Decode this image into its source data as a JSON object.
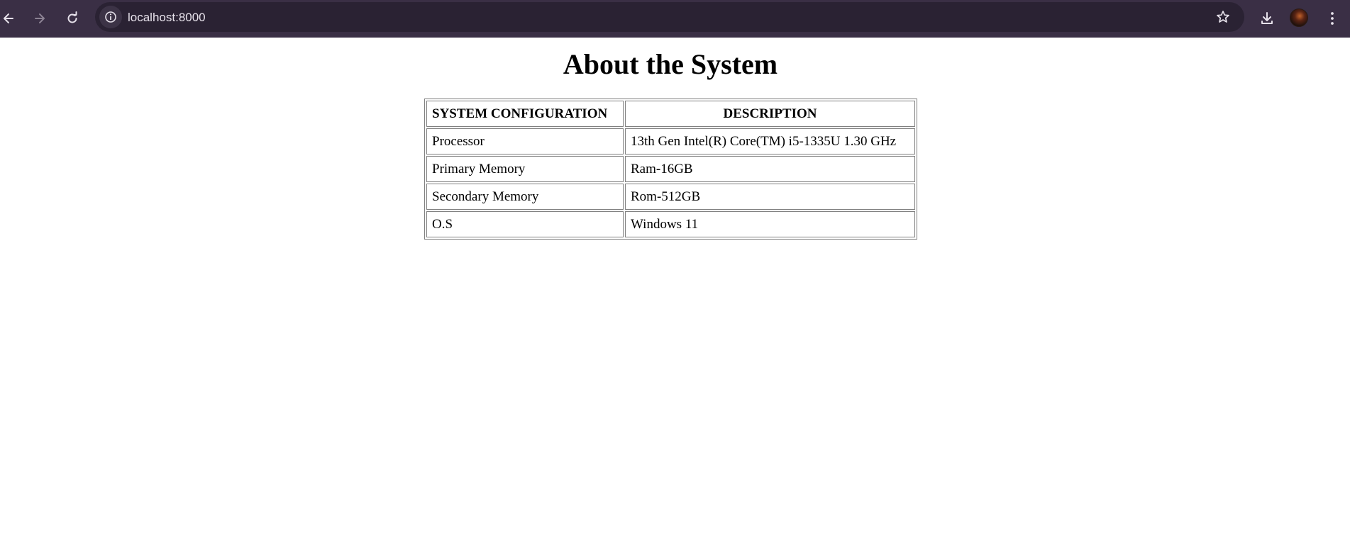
{
  "browser": {
    "back_icon": "arrow-left-icon",
    "forward_icon": "arrow-right-icon",
    "reload_icon": "reload-icon",
    "site_info_icon": "info-circle-icon",
    "url": "localhost:8000",
    "bookmark_icon": "star-outline-icon",
    "download_icon": "download-icon",
    "menu_icon": "kebab-menu-icon"
  },
  "page": {
    "title": "About the System",
    "table": {
      "headers": [
        "SYSTEM CONFIGURATION",
        "DESCRIPTION"
      ],
      "rows": [
        [
          "Processor",
          "13th Gen Intel(R) Core(TM) i5-1335U 1.30 GHz"
        ],
        [
          "Primary Memory",
          "Ram-16GB"
        ],
        [
          "Secondary Memory",
          "Rom-512GB"
        ],
        [
          "O.S",
          "Windows 11"
        ]
      ]
    }
  }
}
